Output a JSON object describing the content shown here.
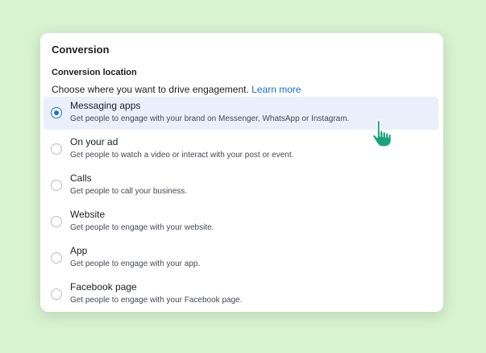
{
  "panel": {
    "title": "Conversion",
    "section_label": "Conversion location",
    "instruction": "Choose where you want to drive engagement.",
    "learn_more": "Learn more"
  },
  "options": [
    {
      "title": "Messaging apps",
      "description": "Get people to engage with your brand on Messenger, WhatsApp or Instagram.",
      "selected": true
    },
    {
      "title": "On your ad",
      "description": "Get people to watch a video or interact with your post or event.",
      "selected": false
    },
    {
      "title": "Calls",
      "description": "Get people to call your business.",
      "selected": false
    },
    {
      "title": "Website",
      "description": "Get people to engage with your website.",
      "selected": false
    },
    {
      "title": "App",
      "description": "Get people to engage with your app.",
      "selected": false
    },
    {
      "title": "Facebook page",
      "description": "Get people to engage with your Facebook page.",
      "selected": false
    }
  ],
  "colors": {
    "accent": "#1a6ed8",
    "selected_bg": "#ebeffb",
    "page_bg": "#d8f3d0",
    "cursor": "#1aa37a"
  },
  "icons": {
    "cursor": "hand-pointer-icon"
  }
}
